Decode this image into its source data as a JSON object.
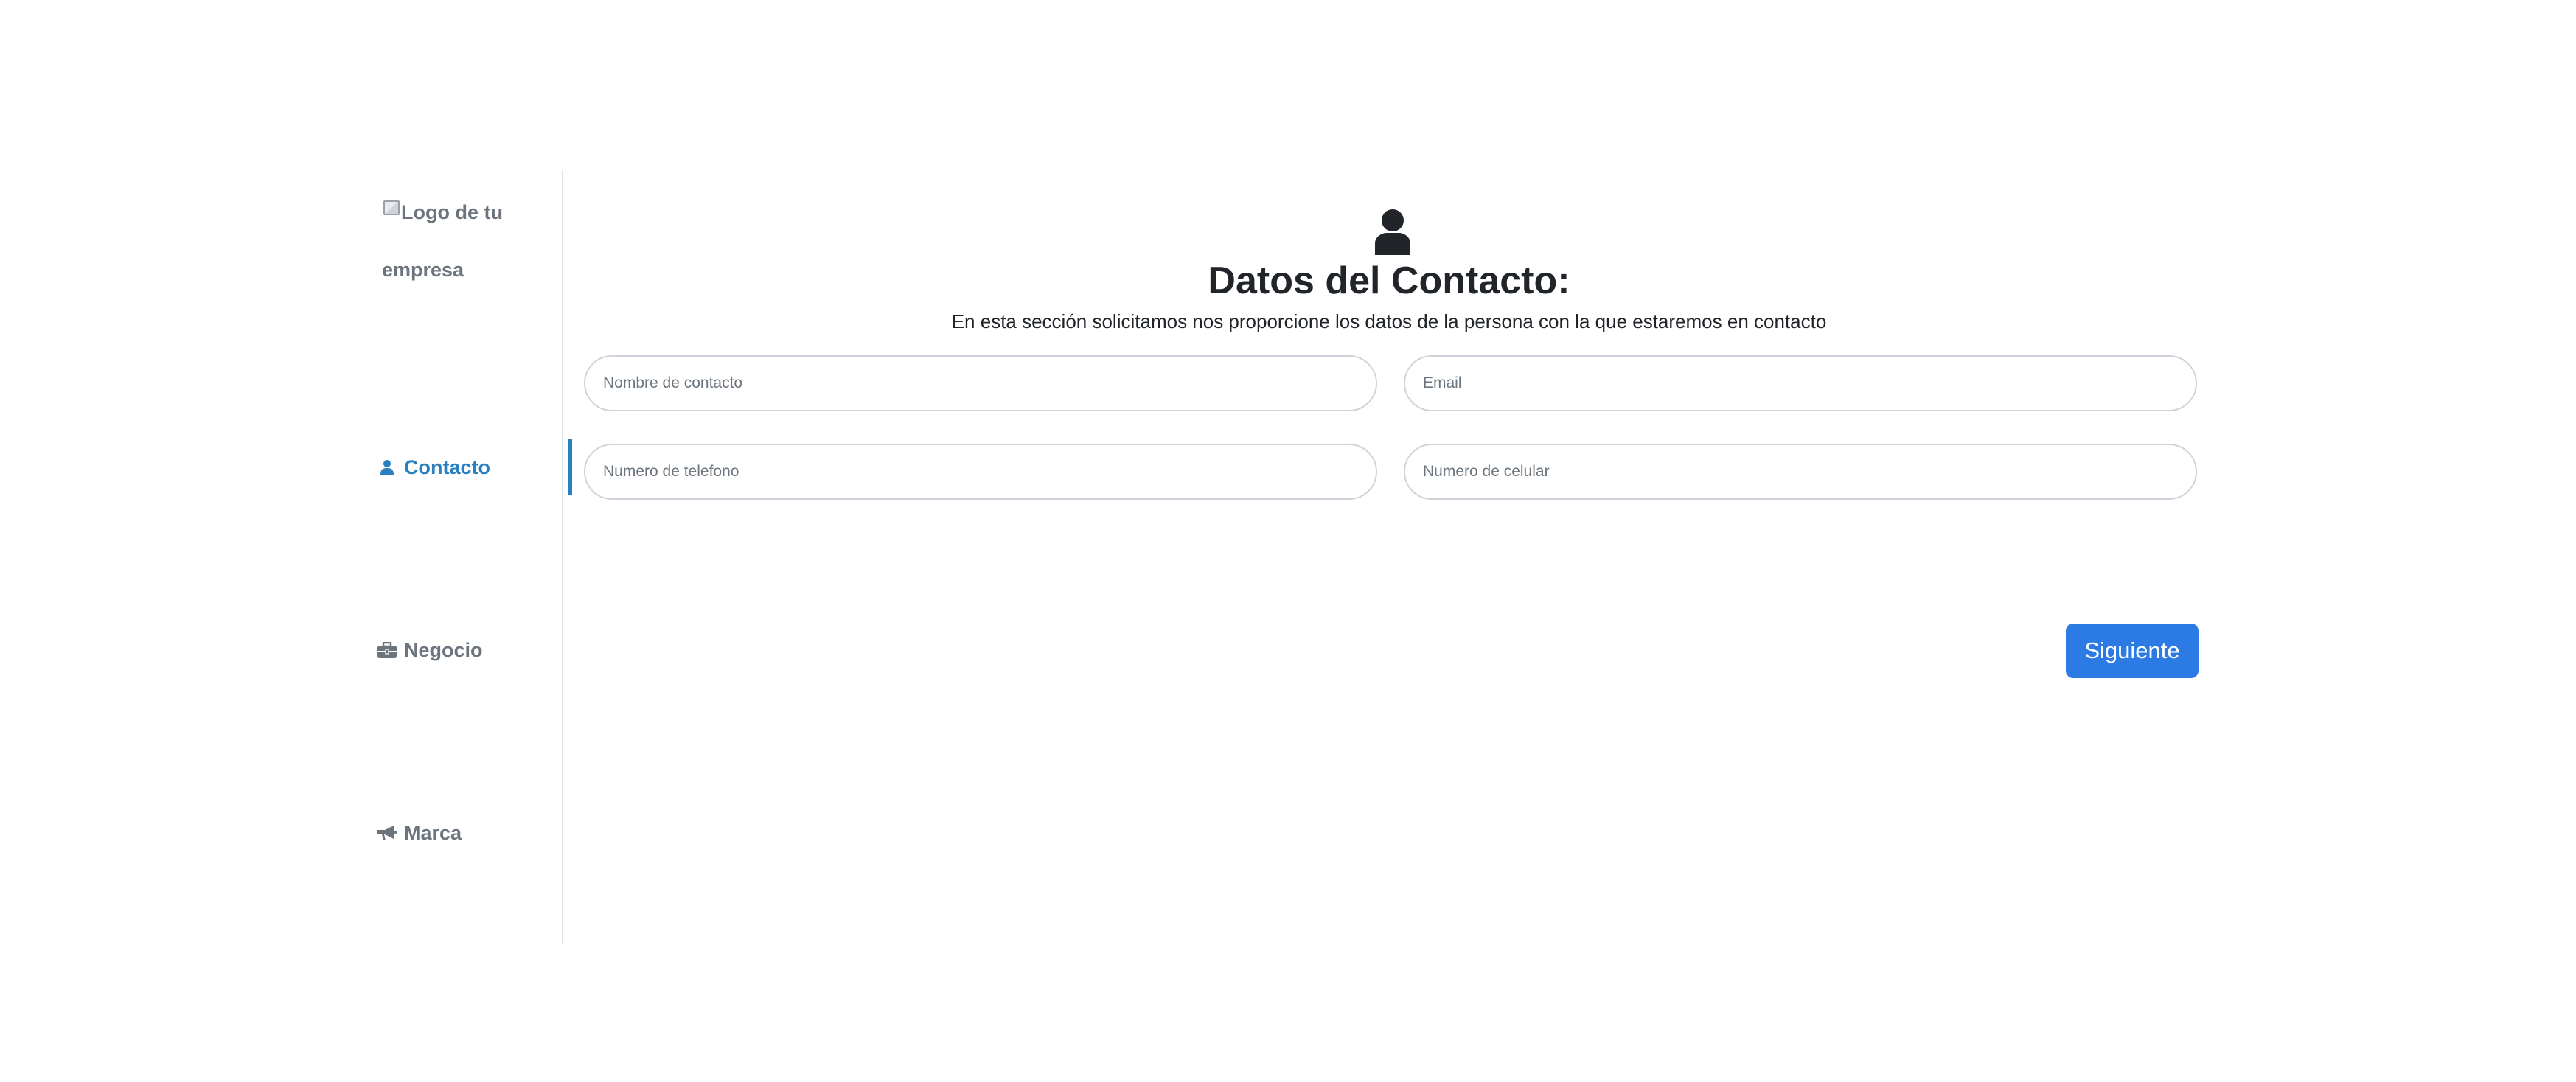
{
  "sidebar": {
    "logo_alt_line1": "Logo de tu",
    "logo_alt_line2": "empresa",
    "items": [
      {
        "label": "Contacto",
        "icon": "user-icon",
        "active": true
      },
      {
        "label": "Negocio",
        "icon": "briefcase-icon",
        "active": false
      },
      {
        "label": "Marca",
        "icon": "megaphone-icon",
        "active": false
      }
    ]
  },
  "main": {
    "icon": "user-icon",
    "title": "Datos del Contacto:",
    "subtitle": "En esta sección solicitamos nos proporcione los datos de la persona con la que estaremos en contacto",
    "fields": {
      "nombre_placeholder": "Nombre de contacto",
      "email_placeholder": "Email",
      "telefono_placeholder": "Numero de telefono",
      "celular_placeholder": "Numero de celular"
    },
    "next_label": "Siguiente"
  },
  "colors": {
    "accent": "#2a7fc1",
    "button": "#2c7be5",
    "muted": "#6c757d"
  }
}
